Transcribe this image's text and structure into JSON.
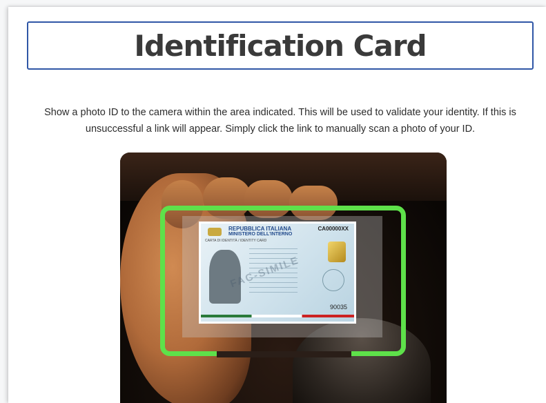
{
  "header": {
    "title": "Identification Card"
  },
  "instructions": "Show a photo ID to the camera within the area indicated. This will be used to validate your identity. If this is unsuccessful a link will appear. Simply click the link to manually scan a photo of your ID.",
  "camera": {
    "frame_color": "#5ee14a",
    "id_card": {
      "country": "REPUBBLICA ITALIANA",
      "ministry": "MINISTERO DELL'INTERNO",
      "document": "CARTA DI IDENTITÀ / IDENTITY CARD",
      "card_number": "CA00000XX",
      "watermark": "FAC-SIMILE",
      "code": "90035"
    }
  },
  "colors": {
    "title_border": "#2f56a6",
    "title_text": "#3a3a3a"
  }
}
